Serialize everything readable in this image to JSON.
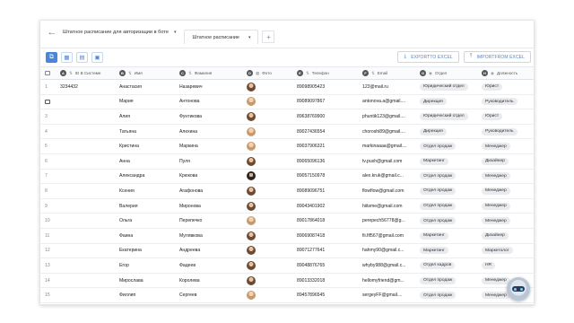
{
  "header": {
    "title": "Штатное расписание для авторизации в боте",
    "tab_label": "Штатное расписание"
  },
  "toolbar": {
    "export_label": "EXPORTTO EXCEL",
    "import_label": "IMPORTFROM EXCEL"
  },
  "columns": [
    "ID В Системе",
    "Имя",
    "Фамилия",
    "Фото",
    "Телефон",
    "Email",
    "Отдел",
    "Должность"
  ],
  "rows": [
    {
      "n": "1",
      "id": "3234432",
      "name": "Анастасия",
      "surname": "Назаревич",
      "phone": "89098905423",
      "email": "123@mail.ru",
      "dept": "Юридический отдел",
      "pos": "Юрист"
    },
    {
      "n": "",
      "id": "",
      "name": "Мария",
      "surname": "Антонова",
      "phone": "89089097867",
      "email": "antonova.a@gmail....",
      "dept": "Дирекция",
      "pos": "Руководитель"
    },
    {
      "n": "3",
      "id": "",
      "name": "Алия",
      "surname": "Фунтикова",
      "phone": "89638769900",
      "email": "phuntik123@gmail....",
      "dept": "Юридический отдел",
      "pos": "Юрист"
    },
    {
      "n": "4",
      "id": "",
      "name": "Татьяна",
      "surname": "Алехина",
      "phone": "89027436554",
      "email": "choroshi89@gmail....",
      "dept": "Дирекция",
      "pos": "Руководитель"
    },
    {
      "n": "5",
      "id": "",
      "name": "Кристина",
      "surname": "Маркина",
      "phone": "89037906321",
      "email": "markinaaaa@gmail....",
      "dept": "Отдел продаж",
      "pos": "Менеджер"
    },
    {
      "n": "6",
      "id": "",
      "name": "Анна",
      "surname": "Пуля",
      "phone": "89065096136",
      "email": "tv.push@gmail.com",
      "dept": "Маркетинг",
      "pos": "Дизайнер"
    },
    {
      "n": "7",
      "id": "",
      "name": "Александра",
      "surname": "Крюкова",
      "phone": "89057150978",
      "email": "alex.kruk@gmail.c...",
      "dept": "Отдел продаж",
      "pos": "Менеджер"
    },
    {
      "n": "8",
      "id": "",
      "name": "Ксения",
      "surname": "Агафонова",
      "phone": "89089096751",
      "email": "flowflow@gmail.com",
      "dept": "Отдел продаж",
      "pos": "Менеджер"
    },
    {
      "n": "9",
      "id": "",
      "name": "Валерия",
      "surname": "Миронова",
      "phone": "89043401902",
      "email": "hiitsme@gmail.com",
      "dept": "Отдел продаж",
      "pos": "Менеджер"
    },
    {
      "n": "10",
      "id": "",
      "name": "Ольга",
      "surname": "Перепечко",
      "phone": "89017864018",
      "email": "perepech56778@g...",
      "dept": "Отдел продаж",
      "pos": "Менеджер"
    },
    {
      "n": "11",
      "id": "",
      "name": "Фаина",
      "surname": "Мулявкова",
      "phone": "89069087418",
      "email": "fii.fif567@gmail.com",
      "dept": "Маркетинг",
      "pos": "Дизайнер"
    },
    {
      "n": "12",
      "id": "",
      "name": "Екатерина",
      "surname": "Андреева",
      "phone": "89071277641",
      "email": "hahmy90@gmail.c...",
      "dept": "Маркетинг",
      "pos": "Маркетолог"
    },
    {
      "n": "13",
      "id": "",
      "name": "Егор",
      "surname": "Фадеев",
      "phone": "89048876765",
      "email": "whyby988@gmail.c...",
      "dept": "Отдел кадров",
      "pos": "HR"
    },
    {
      "n": "14",
      "id": "",
      "name": "Мирослава",
      "surname": "Королева",
      "phone": "89013332018",
      "email": "hellomyfriend@gm...",
      "dept": "Отдел продаж",
      "pos": "Менеджер"
    },
    {
      "n": "15",
      "id": "",
      "name": "Филлип",
      "surname": "Сергеев",
      "phone": "89457896545",
      "email": "sergeyFF@gmail....",
      "dept": "Отдел продаж",
      "pos": "Менеджер"
    }
  ]
}
